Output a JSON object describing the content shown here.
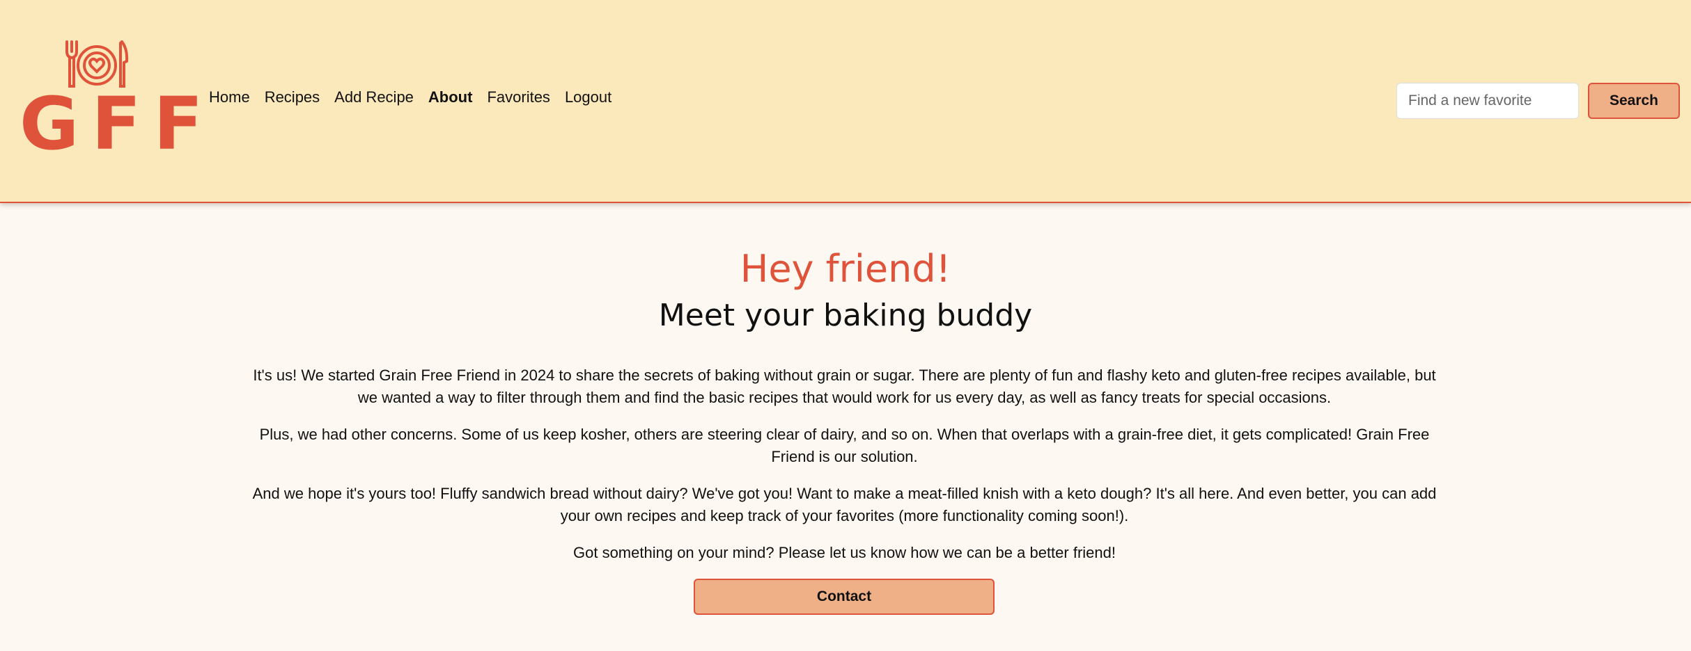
{
  "brand": {
    "logo_text": "GFF",
    "icon": "plate-fork-knife-heart-icon",
    "color": "#e0533b"
  },
  "nav": {
    "items": [
      {
        "label": "Home",
        "active": false
      },
      {
        "label": "Recipes",
        "active": false
      },
      {
        "label": "Add Recipe",
        "active": false
      },
      {
        "label": "About",
        "active": true
      },
      {
        "label": "Favorites",
        "active": false
      },
      {
        "label": "Logout",
        "active": false
      }
    ]
  },
  "search": {
    "placeholder": "Find a new favorite",
    "value": "",
    "button_label": "Search"
  },
  "main": {
    "greeting": "Hey friend!",
    "subtitle": "Meet your baking buddy",
    "paragraphs": [
      "It's us! We started Grain Free Friend in 2024 to share the secrets of baking without grain or sugar. There are plenty of fun and flashy keto and gluten-free recipes available, but we wanted a way to filter through them and find the basic recipes that would work for us every day, as well as fancy treats for special occasions.",
      "Plus, we had other concerns. Some of us keep kosher, others are steering clear of dairy, and so on. When that overlaps with a grain-free diet, it gets complicated! Grain Free Friend is our solution.",
      "And we hope it's yours too! Fluffy sandwich bread without dairy? We've got you! Want to make a meat-filled knish with a keto dough? It's all here. And even better, you can add your own recipes and keep track of your favorites (more functionality coming soon!).",
      "Got something on your mind? Please let us know how we can be a better friend!"
    ],
    "contact_label": "Contact"
  },
  "colors": {
    "header_bg": "#fbe9bb",
    "page_bg": "#fdf8f1",
    "accent": "#e0533b",
    "button_bg": "#efaf87"
  }
}
